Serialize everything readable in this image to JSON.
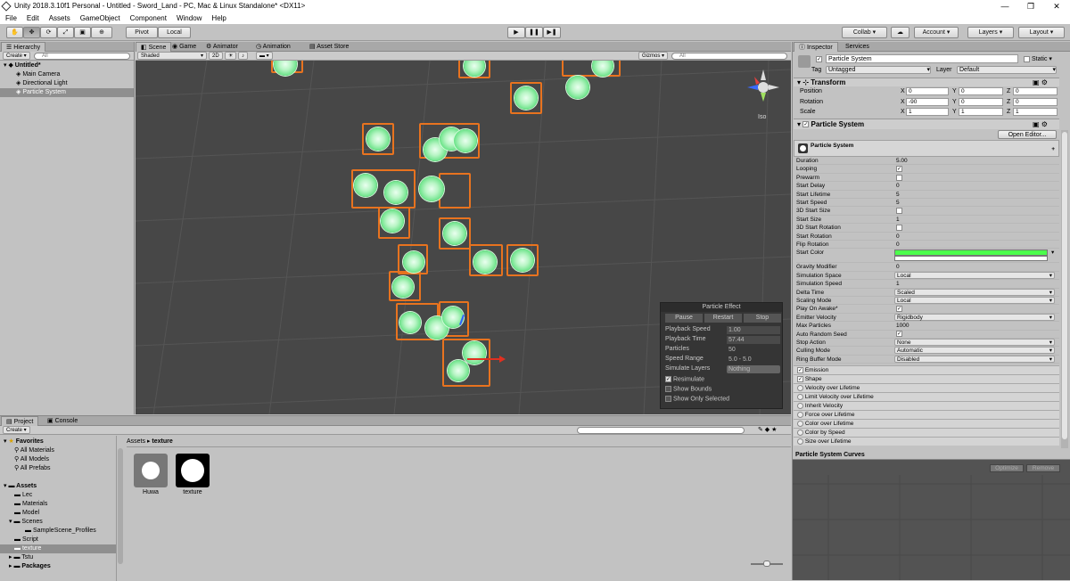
{
  "window": {
    "title": "Unity 2018.3.10f1 Personal - Untitled - Sword_Land - PC, Mac & Linux Standalone* <DX11>"
  },
  "menu": [
    "File",
    "Edit",
    "Assets",
    "GameObject",
    "Component",
    "Window",
    "Help"
  ],
  "toolbar": {
    "pivot": "Pivot",
    "local": "Local",
    "collab": "Collab ▾",
    "account": "Account",
    "layers": "Layers",
    "layout": "Layout"
  },
  "hierarchy": {
    "tab": "Hierarchy",
    "create": "Create",
    "scene": "Untitled*",
    "items": [
      "Main Camera",
      "Directional Light",
      "Particle System"
    ]
  },
  "scene_tabs": [
    "Scene",
    "Game",
    "Animator",
    "Animation",
    "Asset Store"
  ],
  "scene_toolbar": {
    "shading": "Shaded",
    "mode2d": "2D",
    "gizmos": "Gizmos",
    "search": "All"
  },
  "gizmo": {
    "label": "Iso"
  },
  "particle_effect": {
    "title": "Particle Effect",
    "buttons": [
      "Pause",
      "Restart",
      "Stop"
    ],
    "rows": [
      {
        "label": "Playback Speed",
        "value": "1.00"
      },
      {
        "label": "Playback Time",
        "value": "57.44"
      },
      {
        "label": "Particles",
        "value": "50"
      },
      {
        "label": "Speed Range",
        "value": "5.0 - 5.0"
      },
      {
        "label": "Simulate Layers",
        "value": "Nothing"
      }
    ],
    "checks": [
      {
        "label": "Resimulate",
        "checked": true
      },
      {
        "label": "Show Bounds",
        "checked": false
      },
      {
        "label": "Show Only Selected",
        "checked": false
      }
    ]
  },
  "project": {
    "tabs": [
      "Project",
      "Console"
    ],
    "create": "Create",
    "favorites_label": "Favorites",
    "favorites": [
      "All Materials",
      "All Models",
      "All Prefabs"
    ],
    "assets_label": "Assets",
    "folders": [
      "Lec",
      "Materials",
      "Model",
      "Scenes",
      "SampleScene_Profiles",
      "Script",
      "texture",
      "Tstu"
    ],
    "packages": "Packages",
    "breadcrumb": [
      "Assets",
      "texture"
    ],
    "files": [
      "Huwa",
      "texture"
    ]
  },
  "inspector": {
    "tabs": [
      "Inspector",
      "Services"
    ],
    "object_name": "Particle System",
    "static": "Static",
    "tag_label": "Tag",
    "tag": "Untagged",
    "layer_label": "Layer",
    "layer": "Default",
    "transform": {
      "title": "Transform",
      "rows": [
        {
          "label": "Position",
          "x": "0",
          "y": "0",
          "z": "0"
        },
        {
          "label": "Rotation",
          "x": "-90",
          "y": "0",
          "z": "0"
        },
        {
          "label": "Scale",
          "x": "1",
          "y": "1",
          "z": "1"
        }
      ]
    },
    "ps_component": "Particle System",
    "open_editor": "Open Editor...",
    "ps_header": "Particle System",
    "fields": [
      {
        "k": "Duration",
        "v": "5.00"
      },
      {
        "k": "Looping",
        "v": "✓"
      },
      {
        "k": "Prewarm",
        "v": ""
      },
      {
        "k": "Start Delay",
        "v": "0"
      },
      {
        "k": "Start Lifetime",
        "v": "5"
      },
      {
        "k": "Start Speed",
        "v": "5"
      },
      {
        "k": "3D Start Size",
        "v": ""
      },
      {
        "k": "Start Size",
        "v": "1"
      },
      {
        "k": "3D Start Rotation",
        "v": ""
      },
      {
        "k": "Start Rotation",
        "v": "0"
      },
      {
        "k": "Flip Rotation",
        "v": "0"
      },
      {
        "k": "Start Color",
        "v": ""
      },
      {
        "k": "Gravity Modifier",
        "v": "0"
      },
      {
        "k": "Simulation Space",
        "v": "Local"
      },
      {
        "k": "Simulation Speed",
        "v": "1"
      },
      {
        "k": "Delta Time",
        "v": "Scaled"
      },
      {
        "k": "Scaling Mode",
        "v": "Local"
      },
      {
        "k": "Play On Awake*",
        "v": "✓"
      },
      {
        "k": "Emitter Velocity",
        "v": "Rigidbody"
      },
      {
        "k": "Max Particles",
        "v": "1000"
      },
      {
        "k": "Auto Random Seed",
        "v": "✓"
      },
      {
        "k": "Stop Action",
        "v": "None"
      },
      {
        "k": "Culling Mode",
        "v": "Automatic"
      },
      {
        "k": "Ring Buffer Mode",
        "v": "Disabled"
      }
    ],
    "modules": [
      "Emission",
      "Shape",
      "Velocity over Lifetime",
      "Limit Velocity over Lifetime",
      "Inherit Velocity",
      "Force over Lifetime",
      "Color over Lifetime",
      "Color by Speed",
      "Size over Lifetime"
    ]
  },
  "curves": {
    "title": "Particle System Curves",
    "optimize": "Optimize",
    "remove": "Remove"
  },
  "colors": {
    "start_color": "#4cff4c",
    "selection": "#e8731f",
    "particle": "#5fe07f"
  }
}
